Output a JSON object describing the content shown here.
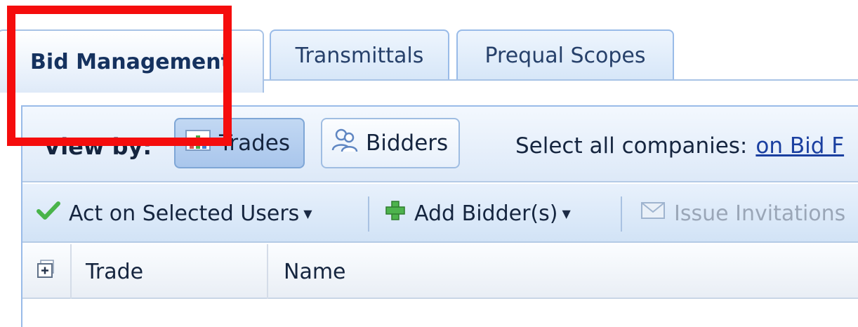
{
  "tabs": [
    {
      "label": "Bid Management",
      "active": true
    },
    {
      "label": "Transmittals",
      "active": false
    },
    {
      "label": "Prequal Scopes",
      "active": false
    }
  ],
  "viewby": {
    "label": "View by:",
    "trades_label": "Trades",
    "bidders_label": "Bidders",
    "select_all_text": "Select all companies:",
    "select_all_link": "on Bid F"
  },
  "actions": {
    "act_selected": "Act on Selected Users",
    "add_bidder": "Add Bidder(s)",
    "issue_invitations": "Issue Invitations"
  },
  "grid": {
    "columns": [
      "Trade",
      "Name"
    ]
  },
  "colors": {
    "highlight": "#f50d0d",
    "accent_border": "#99bbe8"
  }
}
